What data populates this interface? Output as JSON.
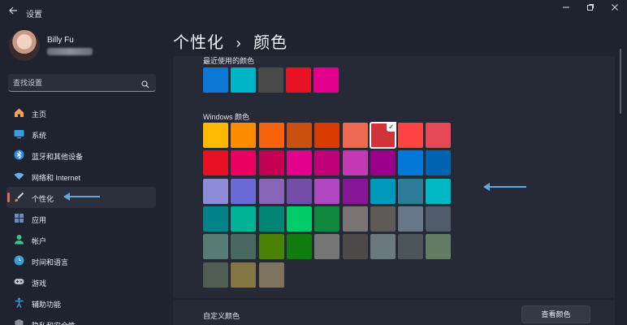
{
  "window": {
    "title": "设置",
    "back_icon": "back-arrow-icon",
    "controls": [
      "minimize-icon",
      "maximize-icon",
      "close-icon"
    ]
  },
  "user": {
    "name": "Billy Fu",
    "email": ""
  },
  "search": {
    "placeholder": "查找设置",
    "value": ""
  },
  "sidebar": {
    "items": [
      {
        "label": "主页",
        "icon": "home-icon",
        "color": "#f0a35a"
      },
      {
        "label": "系统",
        "icon": "system-icon",
        "color": "#3a9be0"
      },
      {
        "label": "蓝牙和其他设备",
        "icon": "bluetooth-icon",
        "color": "#2f8fe0"
      },
      {
        "label": "网络和 Internet",
        "icon": "wifi-icon",
        "color": "#5fb2e6"
      },
      {
        "label": "个性化",
        "icon": "brush-icon",
        "color": "#e08a5a",
        "selected": true
      },
      {
        "label": "应用",
        "icon": "apps-icon",
        "color": "#6b8cbf"
      },
      {
        "label": "帐户",
        "icon": "account-icon",
        "color": "#3fc08a"
      },
      {
        "label": "时间和语言",
        "icon": "globe-clock-icon",
        "color": "#3a9be0"
      },
      {
        "label": "游戏",
        "icon": "gamepad-icon",
        "color": "#b8bcc6"
      },
      {
        "label": "辅助功能",
        "icon": "accessibility-icon",
        "color": "#3a9be0"
      },
      {
        "label": "隐私和安全性",
        "icon": "shield-icon",
        "color": "#8a8e99"
      }
    ]
  },
  "breadcrumb": {
    "parent": "个性化",
    "separator": "›",
    "current": "颜色"
  },
  "recent_colors": {
    "label": "最近使用的颜色",
    "colors": [
      "#0a78d4",
      "#00b4c8",
      "#4a4a4a",
      "#e81224",
      "#e3008c"
    ]
  },
  "windows_colors": {
    "label": "Windows 颜色",
    "selected": "#d13438",
    "rows": [
      [
        "#ffb900",
        "#ff8c00",
        "#f7630c",
        "#ca5010",
        "#da3b01",
        "#ef6950",
        "#d13438",
        "#ff4343",
        "#e74856"
      ],
      [
        "#e81123",
        "#ea005e",
        "#c30052",
        "#e3008c",
        "#bf0077",
        "#c239b3",
        "#9a0089",
        "#0078d7",
        "#0063b1"
      ],
      [
        "#8e8cd8",
        "#6b69d6",
        "#8764b8",
        "#744da9",
        "#b146c2",
        "#881798",
        "#0099bc",
        "#2d7d9a",
        "#00b7c3"
      ],
      [
        "#038387",
        "#00b294",
        "#018574",
        "#00cc6a",
        "#10893e",
        "#7a7574",
        "#5d5a58",
        "#68768a",
        "#515c6b"
      ],
      [
        "#567c73",
        "#486860",
        "#498205",
        "#107c10",
        "#767676",
        "#4c4a48",
        "#69797e",
        "#4a5459",
        "#647c64"
      ],
      [
        "#525e54",
        "#847545",
        "#7e735f"
      ]
    ]
  },
  "custom_colors": {
    "label": "自定义颜色",
    "button_label": "查看颜色"
  },
  "annotation_color": "#5fa8e0"
}
